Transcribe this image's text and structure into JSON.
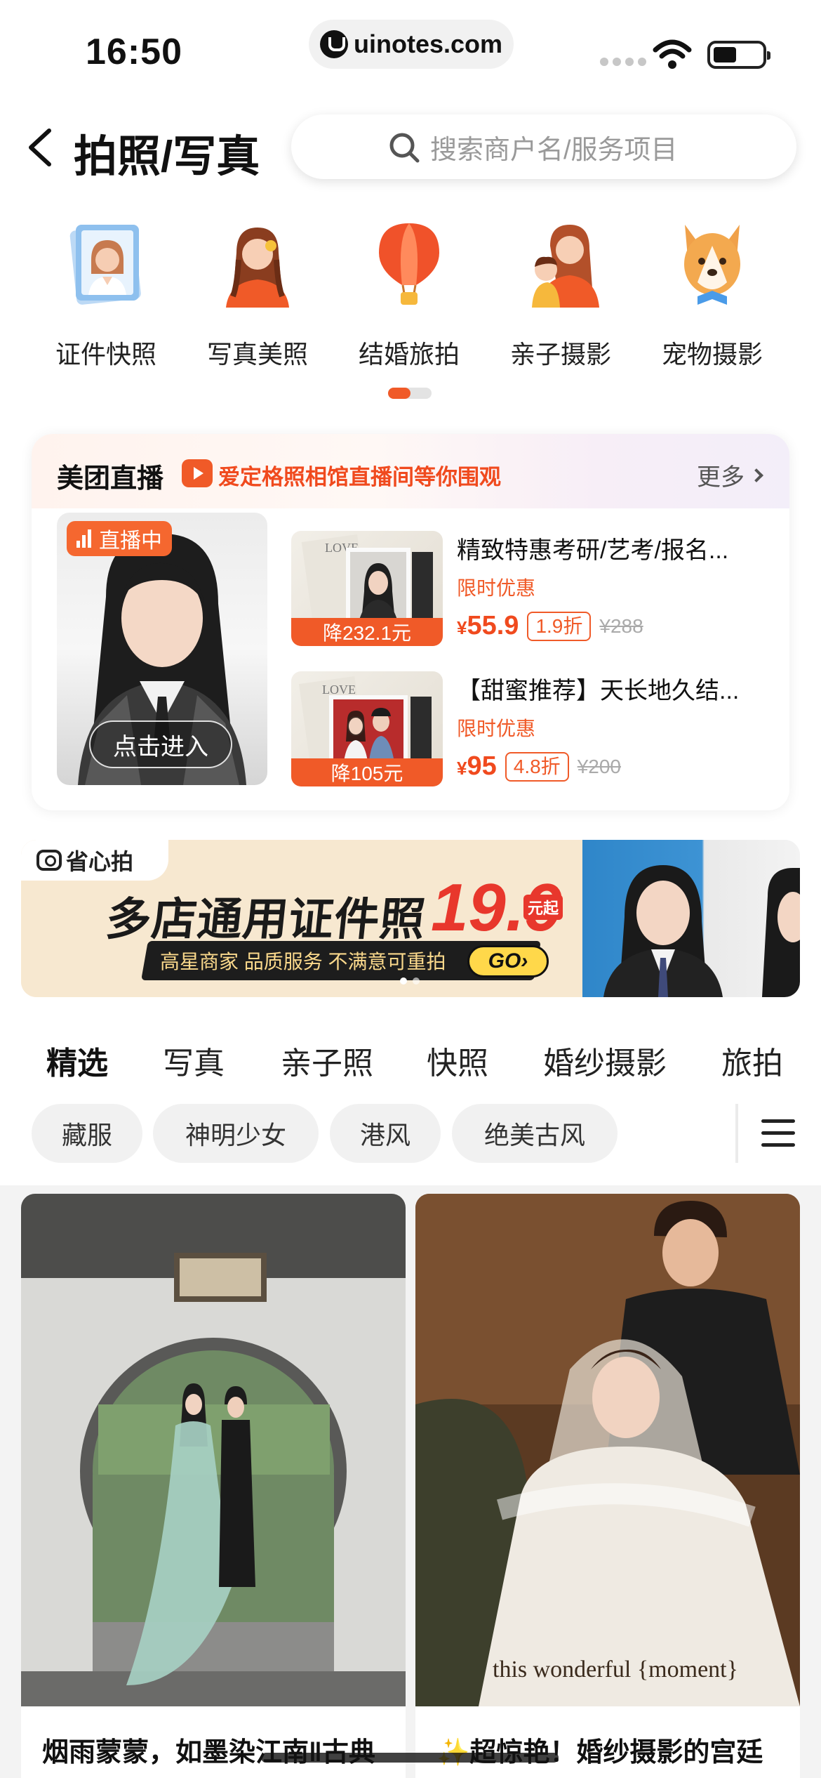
{
  "status_bar": {
    "time": "16:50",
    "url": "uinotes.com"
  },
  "header": {
    "title": "拍照/写真",
    "search_placeholder": "搜索商户名/服务项目"
  },
  "categories": [
    {
      "label": "证件快照",
      "icon": "id-photo-icon"
    },
    {
      "label": "写真美照",
      "icon": "portrait-girl-icon"
    },
    {
      "label": "结婚旅拍",
      "icon": "hot-air-balloon-icon"
    },
    {
      "label": "亲子摄影",
      "icon": "mother-child-icon"
    },
    {
      "label": "宠物摄影",
      "icon": "corgi-dog-icon"
    }
  ],
  "live": {
    "title": "美团直播",
    "subtitle": "爱定格照相馆直播间等你围观",
    "more": "更多",
    "live_tag": "直播中",
    "enter": "点击进入",
    "deals": [
      {
        "title": "精致特惠考研/艺考/报名...",
        "discount": "降232.1元",
        "promo": "限时优惠",
        "price_symbol": "¥",
        "price": "55.9",
        "rate": "1.9折",
        "original": "¥288"
      },
      {
        "title": "【甜蜜推荐】天长地久结...",
        "discount": "降105元",
        "promo": "限时优惠",
        "price_symbol": "¥",
        "price": "95",
        "rate": "4.8折",
        "original": "¥200"
      }
    ]
  },
  "banner": {
    "brand": "省心拍",
    "headline": "多店通用证件照",
    "price": "19.9",
    "price_unit": "元起",
    "tagline": "高星商家 品质服务 不满意可重拍",
    "go": "GO›"
  },
  "tabs": [
    "精选",
    "写真",
    "亲子照",
    "快照",
    "婚纱摄影",
    "旅拍"
  ],
  "active_tab": "精选",
  "chips": [
    "藏服",
    "神明少女",
    "港风",
    "绝美古风"
  ],
  "feed": [
    {
      "title": "烟雨蒙蒙，如墨染江南‖古典"
    },
    {
      "title": "✨超惊艳！婚纱摄影的宫廷"
    }
  ],
  "colors": {
    "accent": "#f05a28",
    "price": "#f04a1e"
  }
}
